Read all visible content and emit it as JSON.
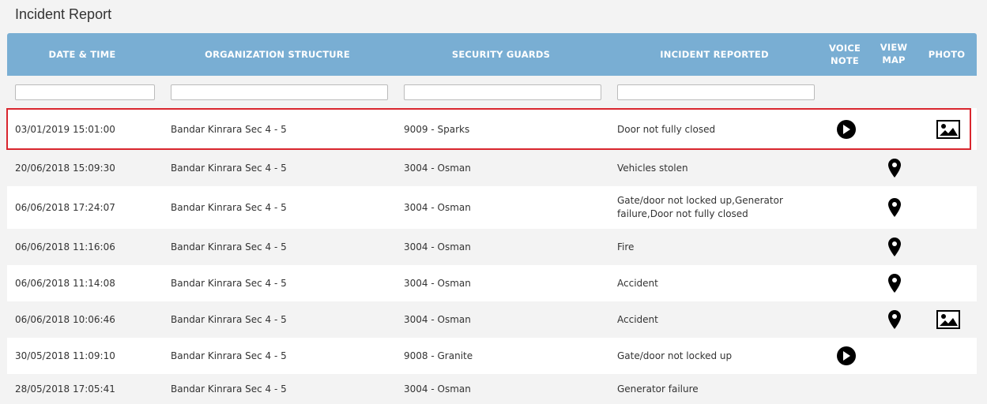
{
  "page": {
    "title": "Incident Report"
  },
  "table": {
    "headers": {
      "datetime": "DATE & TIME",
      "org": "ORGANIZATION STRUCTURE",
      "guards": "SECURITY GUARDS",
      "incident": "INCIDENT REPORTED",
      "voice_line1": "VOICE",
      "voice_line2": "NOTE",
      "map_line1": "VIEW",
      "map_line2": "MAP",
      "photo": "PHOTO"
    },
    "filters": {
      "datetime": "",
      "org": "",
      "guards": "",
      "incident": ""
    },
    "rows": [
      {
        "datetime": "03/01/2019 15:01:00",
        "org": "Bandar Kinrara Sec 4 - 5",
        "guard": "9009 - Sparks",
        "incident": "Door not fully closed",
        "voice": true,
        "map": false,
        "photo": true,
        "selected": true
      },
      {
        "datetime": "20/06/2018 15:09:30",
        "org": "Bandar Kinrara Sec 4 - 5",
        "guard": "3004 - Osman",
        "incident": "Vehicles stolen",
        "voice": false,
        "map": true,
        "photo": false
      },
      {
        "datetime": "06/06/2018 17:24:07",
        "org": "Bandar Kinrara Sec 4 - 5",
        "guard": "3004 - Osman",
        "incident_line1": "Gate/door not locked up,Generator",
        "incident_line2": "failure,Door not fully closed",
        "voice": false,
        "map": true,
        "photo": false
      },
      {
        "datetime": "06/06/2018 11:16:06",
        "org": "Bandar Kinrara Sec 4 - 5",
        "guard": "3004 - Osman",
        "incident": "Fire",
        "voice": false,
        "map": true,
        "photo": false
      },
      {
        "datetime": "06/06/2018 11:14:08",
        "org": "Bandar Kinrara Sec 4 - 5",
        "guard": "3004 - Osman",
        "incident": "Accident",
        "voice": false,
        "map": true,
        "photo": false
      },
      {
        "datetime": "06/06/2018 10:06:46",
        "org": "Bandar Kinrara Sec 4 - 5",
        "guard": "3004 - Osman",
        "incident": "Accident",
        "voice": false,
        "map": true,
        "photo": true
      },
      {
        "datetime": "30/05/2018 11:09:10",
        "org": "Bandar Kinrara Sec 4 - 5",
        "guard": "9008 - Granite",
        "incident": "Gate/door not locked up",
        "voice": true,
        "map": false,
        "photo": false
      },
      {
        "datetime": "28/05/2018 17:05:41",
        "org": "Bandar Kinrara Sec 4 - 5",
        "guard": "3004 - Osman",
        "incident": "Generator failure",
        "voice": false,
        "map": false,
        "photo": false
      }
    ]
  },
  "colors": {
    "header_bg": "#79aed3",
    "selected_border": "#d9262e"
  },
  "icons": {
    "voice": "play-icon",
    "map": "map-pin-icon",
    "photo": "image-icon"
  }
}
